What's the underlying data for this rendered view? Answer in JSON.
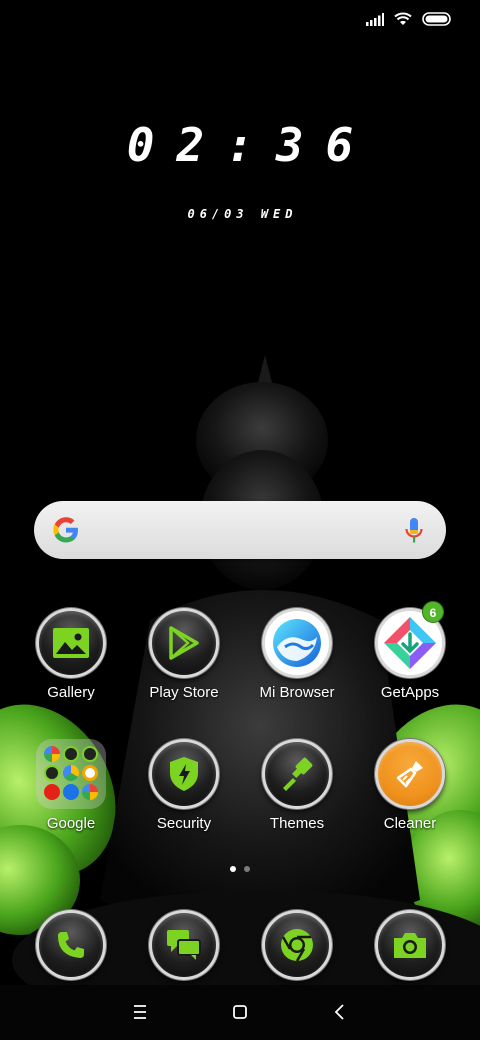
{
  "status_bar": {
    "icons": [
      "signal-icon",
      "wifi-icon",
      "battery-icon"
    ]
  },
  "clock": {
    "time": "02:36",
    "date": "06/03 WED"
  },
  "search": {
    "icons": [
      "google-logo-icon",
      "microphone-icon"
    ]
  },
  "apps": [
    {
      "label": "Gallery",
      "icon": "gallery-icon"
    },
    {
      "label": "Play Store",
      "icon": "play-store-icon"
    },
    {
      "label": "Mi Browser",
      "icon": "mi-browser-icon"
    },
    {
      "label": "GetApps",
      "icon": "getapps-icon",
      "badge": "6"
    },
    {
      "label": "Google",
      "icon": "google-folder-icon"
    },
    {
      "label": "Security",
      "icon": "security-icon"
    },
    {
      "label": "Themes",
      "icon": "themes-icon"
    },
    {
      "label": "Cleaner",
      "icon": "cleaner-icon"
    }
  ],
  "dock": [
    "phone-icon",
    "messages-icon",
    "chrome-icon",
    "camera-icon"
  ],
  "page_indicator": {
    "current": 1,
    "total": 2
  },
  "nav_bar": [
    "menu-icon",
    "home-icon",
    "back-icon"
  ],
  "colors": {
    "accent_green": "#7cd321",
    "badge_green": "#53b52a",
    "cleaner_orange": "#f0921e"
  }
}
